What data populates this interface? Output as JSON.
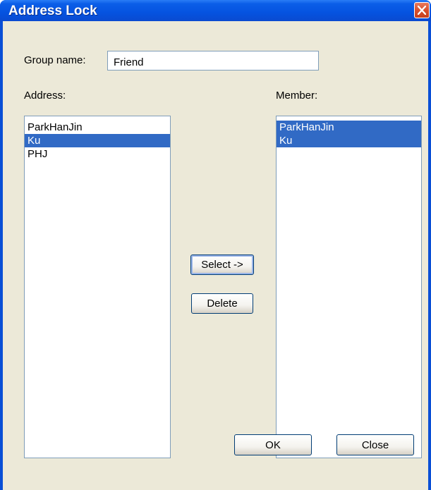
{
  "window": {
    "title": "Address Lock"
  },
  "group": {
    "label": "Group name:",
    "value": "Friend"
  },
  "address": {
    "label": "Address:",
    "items": [
      {
        "text": "ParkHanJin",
        "selected": false
      },
      {
        "text": "Ku",
        "selected": true
      },
      {
        "text": "PHJ",
        "selected": false
      }
    ]
  },
  "member": {
    "label": "Member:",
    "items": [
      {
        "text": "ParkHanJin",
        "selected": true
      },
      {
        "text": "Ku",
        "selected": true
      }
    ]
  },
  "buttons": {
    "select": "Select ->",
    "delete": "Delete",
    "ok": "OK",
    "close": "Close"
  },
  "icons": {
    "window_close": "close-icon"
  },
  "colors": {
    "selection": "#316ac5",
    "titlebar": "#0553e0",
    "dialog_bg": "#ece9d8"
  }
}
